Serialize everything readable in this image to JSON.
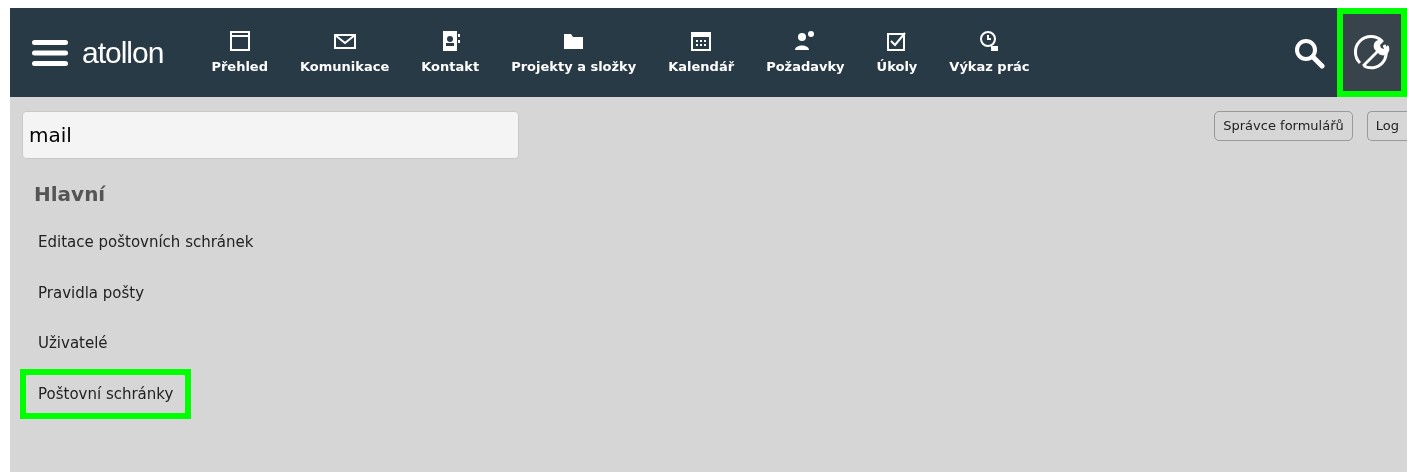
{
  "header": {
    "logo": "atollon",
    "nav": [
      {
        "label": "Přehled"
      },
      {
        "label": "Komunikace"
      },
      {
        "label": "Kontakt"
      },
      {
        "label": "Projekty a složky"
      },
      {
        "label": "Kalendář"
      },
      {
        "label": "Požadavky"
      },
      {
        "label": "Úkoly"
      },
      {
        "label": "Výkaz prác"
      }
    ],
    "settings": {
      "highlighted": true
    }
  },
  "search": {
    "value": "mail"
  },
  "buttons": [
    "Správce formulářů",
    "Log"
  ],
  "section": {
    "title": "Hlavní",
    "items": [
      {
        "label": "Editace poštovních schránek",
        "highlighted": false
      },
      {
        "label": "Pravidla pošty",
        "highlighted": false
      },
      {
        "label": "Uživatelé",
        "highlighted": false
      },
      {
        "label": "Poštovní schránky",
        "highlighted": true
      }
    ]
  }
}
